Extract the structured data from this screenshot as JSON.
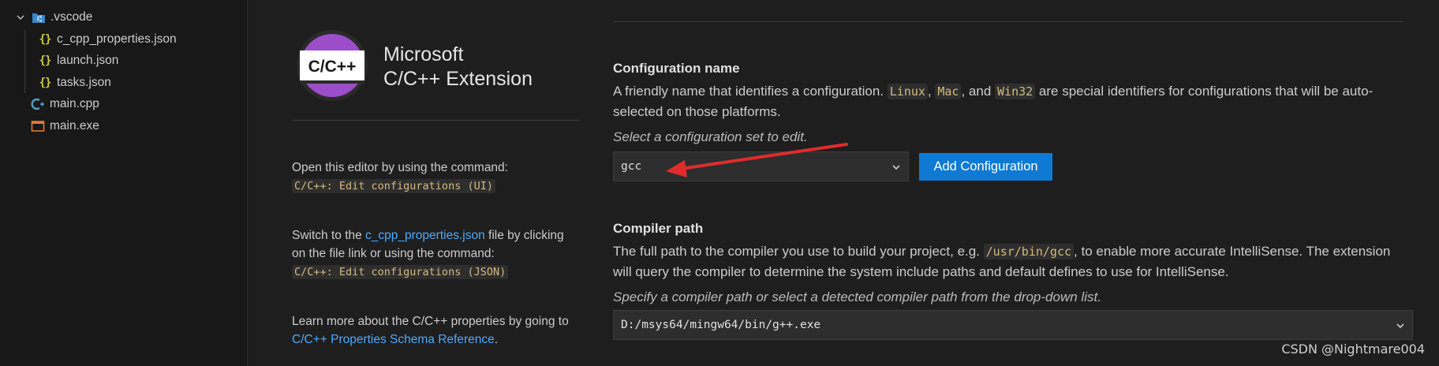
{
  "explorer": {
    "folder": {
      "label": ".vscode",
      "icon": "vscode-folder-icon",
      "expanded": true
    },
    "folder_children": [
      {
        "label": "c_cpp_properties.json",
        "icon": "json-icon"
      },
      {
        "label": "launch.json",
        "icon": "json-icon"
      },
      {
        "label": "tasks.json",
        "icon": "json-icon"
      }
    ],
    "files": [
      {
        "label": "main.cpp",
        "icon": "cpp-file-icon"
      },
      {
        "label": "main.exe",
        "icon": "exe-file-icon"
      }
    ]
  },
  "extension": {
    "logo_text": "C/C++",
    "title_line1": "Microsoft",
    "title_line2": "C/C++ Extension"
  },
  "info": {
    "p1_text": "Open this editor by using the command:",
    "p1_code": "C/C++: Edit configurations (UI)",
    "p2_pre": "Switch to the ",
    "p2_link": "c_cpp_properties.json",
    "p2_post": " file by clicking on the file link or using the command:",
    "p2_code": "C/C++: Edit configurations (JSON)",
    "p3_text": "Learn more about the C/C++ properties by going to ",
    "p3_link": "C/C++ Properties Schema Reference",
    "p3_end": "."
  },
  "config_name": {
    "title": "Configuration name",
    "desc_pre": "A friendly name that identifies a configuration. ",
    "code_linux": "Linux",
    "sep1": ", ",
    "code_mac": "Mac",
    "sep2": ", and ",
    "code_win32": "Win32",
    "desc_post": " are special identifiers for configurations that will be auto-selected on those platforms.",
    "hint": "Select a configuration set to edit.",
    "selected": "gcc",
    "add_button": "Add Configuration"
  },
  "compiler_path": {
    "title": "Compiler path",
    "desc_pre": "The full path to the compiler you use to build your project, e.g. ",
    "desc_code": "/usr/bin/gcc",
    "desc_post": ", to enable more accurate IntelliSense. The extension will query the compiler to determine the system include paths and default defines to use for IntelliSense.",
    "hint": "Specify a compiler path or select a detected compiler path from the drop-down list.",
    "selected": "D:/msys64/mingw64/bin/g++.exe"
  },
  "colors": {
    "accent_button": "#0e7ad3",
    "link": "#4daafc",
    "annotation_arrow": "#e02b2b",
    "logo_purple": "#9b4dca"
  },
  "watermark": "CSDN @Nightmare004"
}
